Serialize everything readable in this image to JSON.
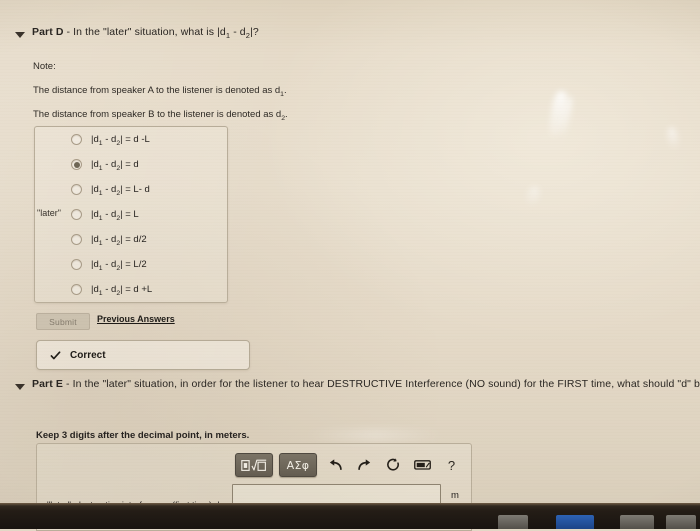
{
  "part_d": {
    "disclosure_icon": "chevron-down-icon",
    "title_bold": "Part D",
    "title_rest": " - In the \"later\" situation, what is |d",
    "title_sub1": "1",
    "title_mid": " - d",
    "title_sub2": "2",
    "title_end": "|?",
    "note": {
      "label": "Note:",
      "line1_pre": "The distance from speaker A to the listener is denoted as d",
      "line1_sub": "1",
      "line1_post": ".",
      "line2_pre": "The distance from speaker B to the listener is denoted as d",
      "line2_sub": "2",
      "line2_post": "."
    },
    "later_tag": "\"later\"",
    "choices": [
      {
        "prefix": "|d",
        "sub1": "1",
        "mid": " - d",
        "sub2": "2",
        "suffix": "| = d -L",
        "selected": false
      },
      {
        "prefix": "|d",
        "sub1": "1",
        "mid": " - d",
        "sub2": "2",
        "suffix": "| = d",
        "selected": true
      },
      {
        "prefix": "|d",
        "sub1": "1",
        "mid": " - d",
        "sub2": "2",
        "suffix": "| = L- d",
        "selected": false
      },
      {
        "prefix": "|d",
        "sub1": "1",
        "mid": " - d",
        "sub2": "2",
        "suffix": "| = L",
        "selected": false
      },
      {
        "prefix": "|d",
        "sub1": "1",
        "mid": " - d",
        "sub2": "2",
        "suffix": "| = d/2",
        "selected": false
      },
      {
        "prefix": "|d",
        "sub1": "1",
        "mid": " - d",
        "sub2": "2",
        "suffix": "| = L/2",
        "selected": false
      },
      {
        "prefix": "|d",
        "sub1": "1",
        "mid": " - d",
        "sub2": "2",
        "suffix": "| = d +L",
        "selected": false
      }
    ],
    "submit_label": "Submit",
    "submit_disabled": true,
    "previous_answers_label": "Previous Answers",
    "feedback": {
      "icon": "check-icon",
      "text": "Correct"
    }
  },
  "part_e": {
    "disclosure_icon": "chevron-down-icon",
    "title_bold": "Part E",
    "title_rest": " - In the \"later\" situation, in order for the listener to hear DESTRUCTIVE Interference (NO sound)  for the FIRST time, what should \"d\" be equal to?",
    "hint": "Keep 3 digits after the decimal point, in meters.",
    "answer_label": "\"later\", destructive interference (first time)  d =",
    "answer_value": "",
    "answer_placeholder": "",
    "unit": "m",
    "toolbar": {
      "template_button": "template-sqrt-icon",
      "greek_button": "ΑΣφ",
      "undo_icon": "undo-arrow-icon",
      "redo_icon": "redo-arrow-icon",
      "reset_icon": "reset-circle-icon",
      "keyboard_icon": "keyboard-icon",
      "help_label": "?"
    }
  },
  "colors": {
    "page_background": "#e6dbc9",
    "text": "#2a2622",
    "panel_border": "#b9ae9a",
    "toolbar_button": "#6a6357",
    "bezel": "#1e1813"
  }
}
